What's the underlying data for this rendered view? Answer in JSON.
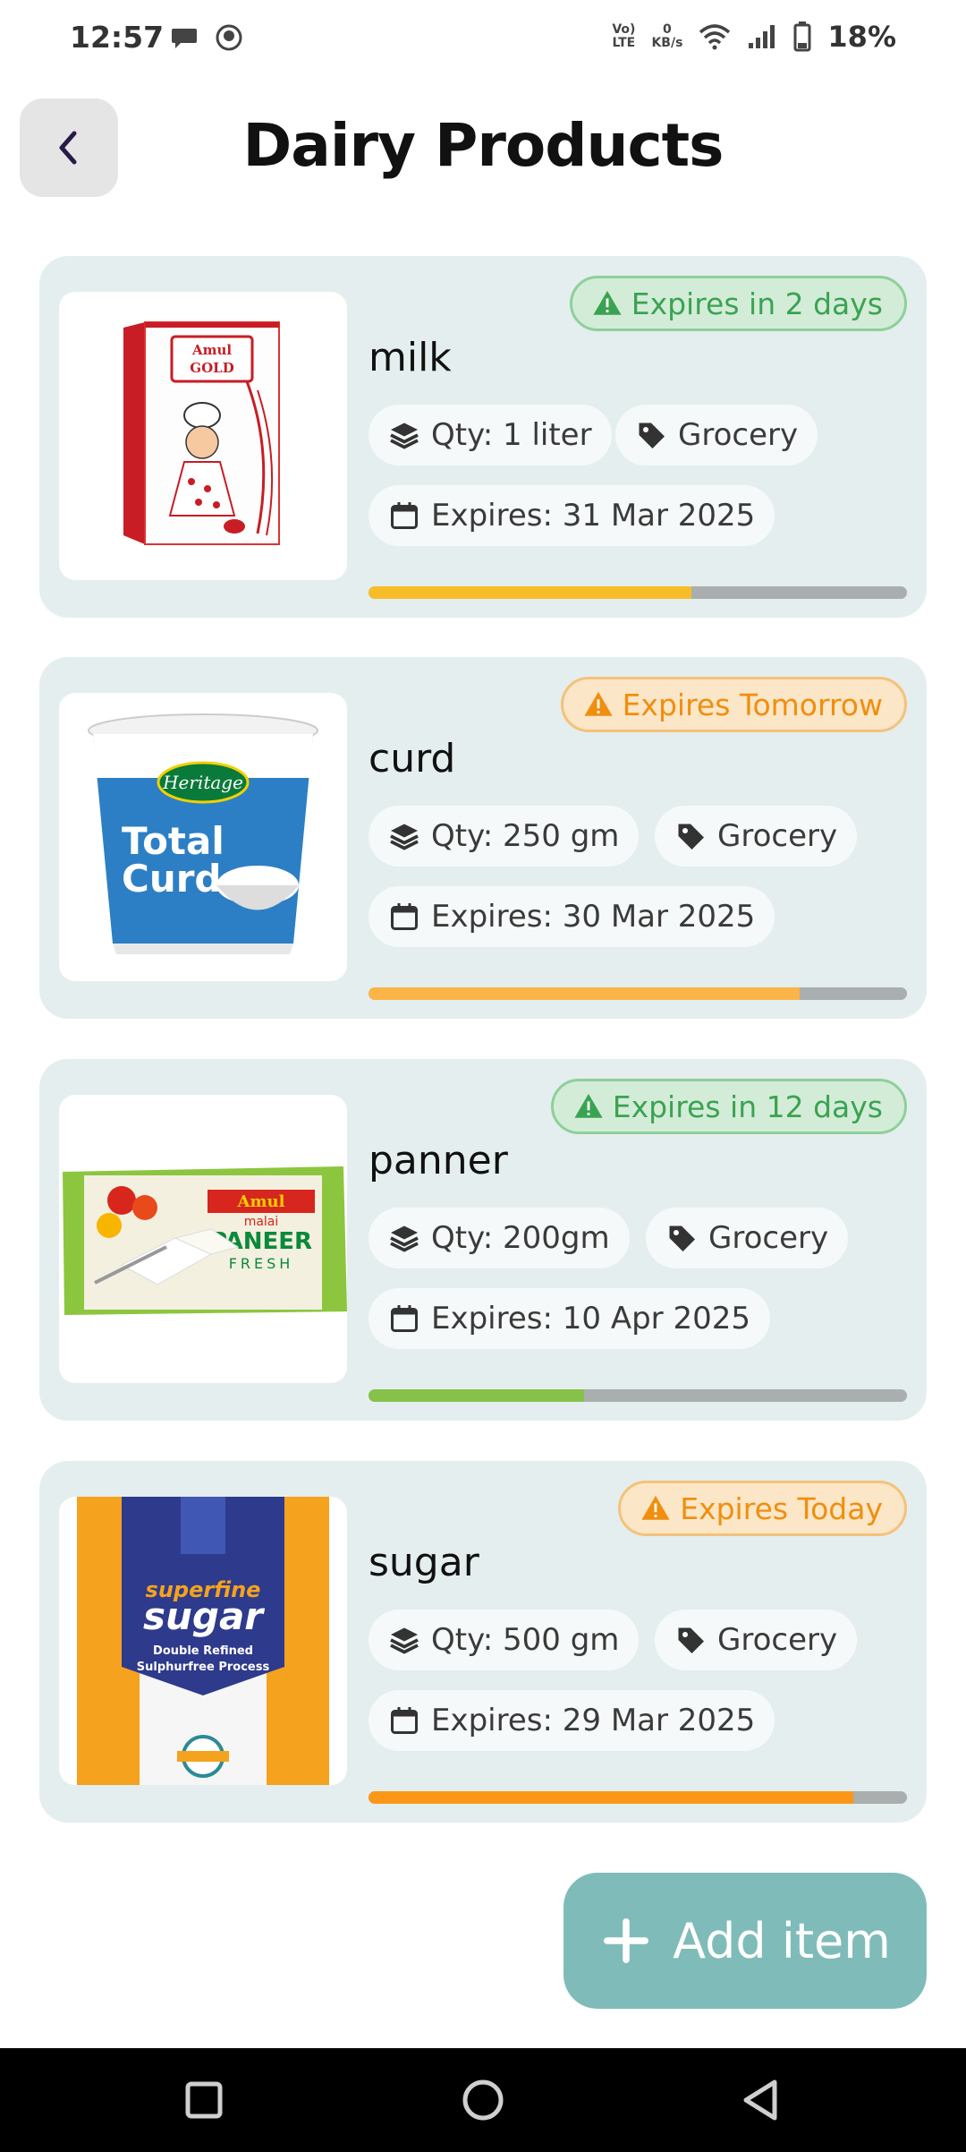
{
  "status_bar": {
    "time": "12:57",
    "network_top": "Vo)",
    "network_bottom": "LTE",
    "speed_value": "0",
    "speed_unit": "KB/s",
    "battery": "18%"
  },
  "header": {
    "title": "Dairy Products",
    "back_icon": "chevron-left-icon"
  },
  "items": [
    {
      "name": "milk",
      "badge": "Expires in 2 days",
      "badge_status": "green",
      "qty": "Qty: 1 liter",
      "category": "Grocery",
      "expires": "Expires: 31 Mar 2025",
      "progress": 0.6,
      "progress_color": "#f7bd28"
    },
    {
      "name": "curd",
      "badge": "Expires Tomorrow",
      "badge_status": "orange",
      "qty": "Qty: 250 gm",
      "category": "Grocery",
      "expires": "Expires: 30 Mar 2025",
      "progress": 0.8,
      "progress_color": "#fbb447"
    },
    {
      "name": "panner",
      "badge": "Expires in 12 days",
      "badge_status": "green",
      "qty": "Qty: 200gm",
      "category": "Grocery",
      "expires": "Expires: 10 Apr 2025",
      "progress": 0.4,
      "progress_color": "#86c24a"
    },
    {
      "name": "sugar",
      "badge": "Expires Today",
      "badge_status": "orange",
      "qty": "Qty: 500 gm",
      "category": "Grocery",
      "expires": "Expires: 29 Mar 2025",
      "progress": 0.9,
      "progress_color": "#fb9718"
    }
  ],
  "product_image_text": {
    "milk_brand": "Amul",
    "milk_variant": "GOLD",
    "curd_brand": "Heritage",
    "curd_line1": "Total",
    "curd_line2": "Curd",
    "paneer_brand": "Amul",
    "paneer_sub": "malai",
    "paneer_line1": "PANEER",
    "paneer_line2": "FRESH",
    "sugar_line1": "superfine",
    "sugar_line2": "sugar",
    "sugar_line3": "Double Refined",
    "sugar_line4": "Sulphurfree Process"
  },
  "fab": {
    "label": "Add item",
    "icon": "plus-icon"
  },
  "navigation": {
    "recents_icon": "square-icon",
    "home_icon": "circle-icon",
    "back_icon": "triangle-back-icon"
  },
  "colors": {
    "card_bg": "#e4eeee",
    "fab_bg": "#7fbcb9",
    "badge_green": "#3aa352",
    "badge_orange": "#f18e0e"
  }
}
